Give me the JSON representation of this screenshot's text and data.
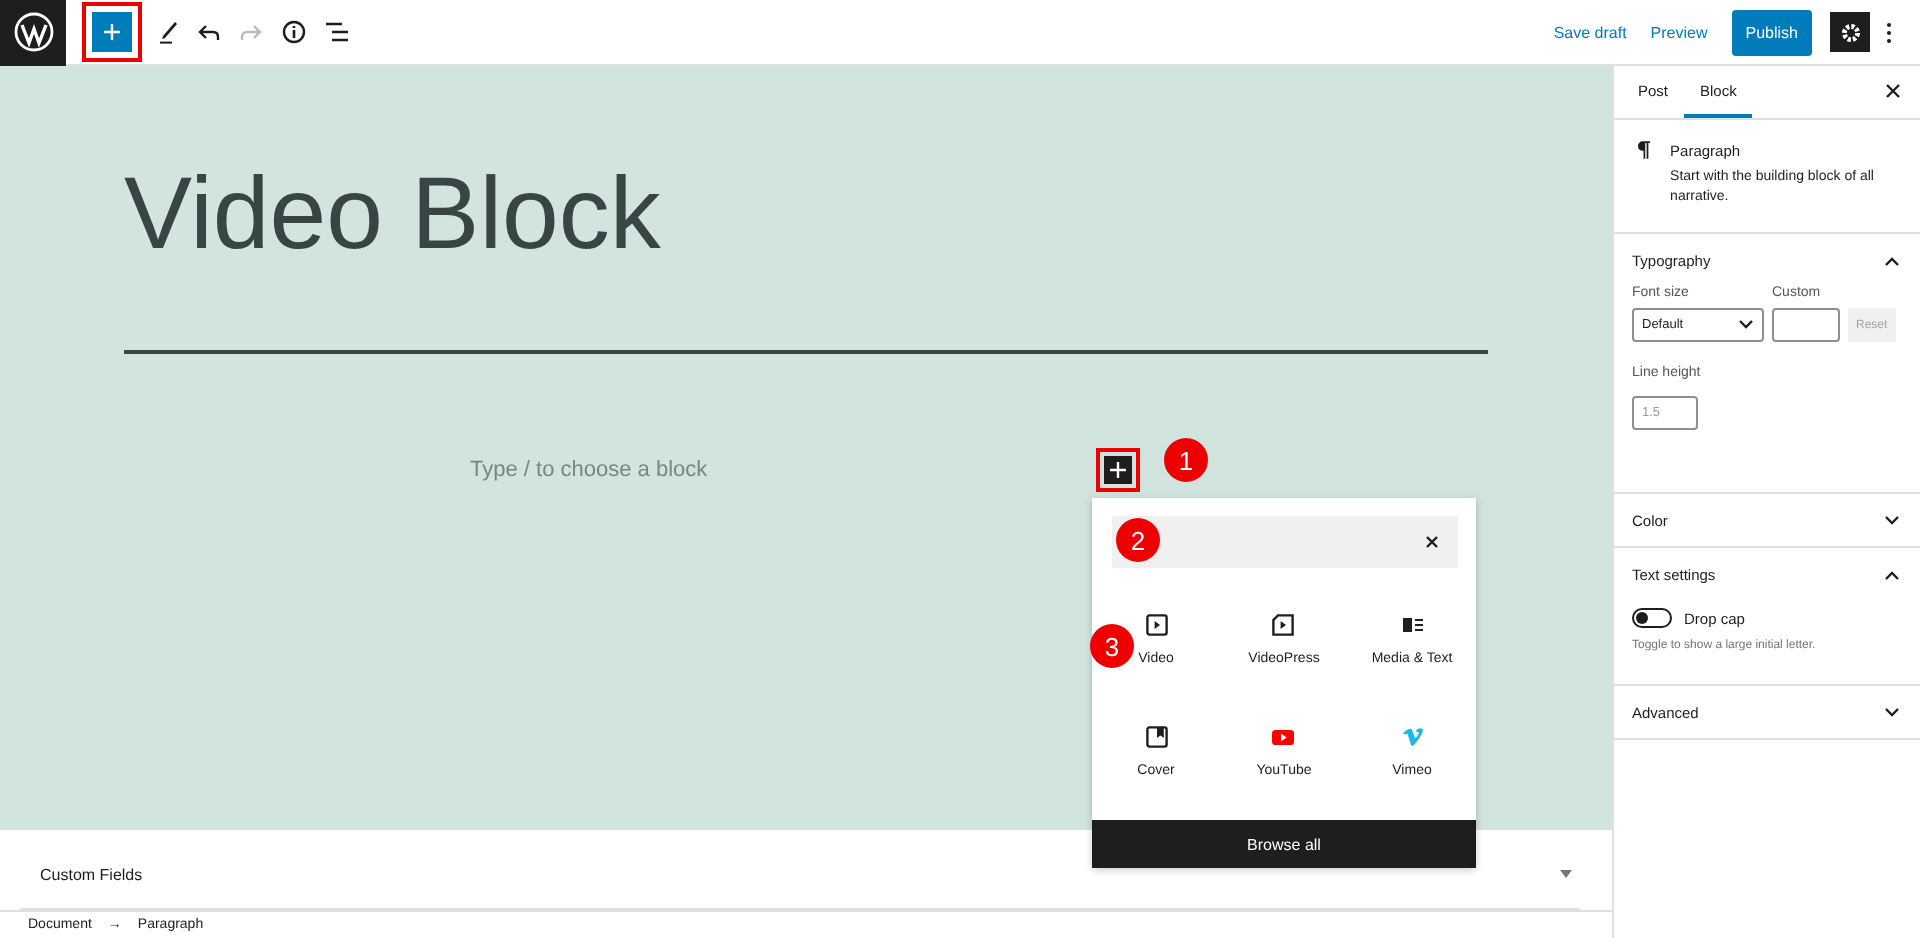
{
  "toolbar": {
    "inserter_open": true,
    "redo_disabled": true
  },
  "actions": [
    {
      "label": "Save draft",
      "kind": "link"
    },
    {
      "label": "Preview",
      "kind": "link"
    },
    {
      "label": "Publish",
      "kind": "primary"
    }
  ],
  "editor": {
    "title": "Video Block",
    "placeholder": "Type / to choose a block"
  },
  "annotations": [
    "1",
    "2",
    "3"
  ],
  "inserter": {
    "blocks": [
      {
        "label": "Video",
        "kind": "video"
      },
      {
        "label": "VideoPress",
        "kind": "videopress"
      },
      {
        "label": "Media & Text",
        "kind": "media-text"
      },
      {
        "label": "Cover",
        "kind": "cover"
      },
      {
        "label": "YouTube",
        "kind": "youtube"
      },
      {
        "label": "Vimeo",
        "kind": "vimeo"
      }
    ],
    "footer": "Browse all"
  },
  "custom_fields": {
    "title": "Custom Fields",
    "expanded": false
  },
  "breadcrumb": {
    "items": [
      "Document",
      "Paragraph"
    ],
    "separator": "→"
  },
  "sidebar": {
    "tabs": [
      {
        "label": "Post",
        "selected": false
      },
      {
        "label": "Block",
        "selected": true
      }
    ],
    "block_card": {
      "name": "Paragraph",
      "description": "Start with the building block of all narrative."
    },
    "panels": [
      {
        "title": "Typography",
        "expanded": true,
        "kind": "typography",
        "font_size_label": "Font size",
        "font_size": "Default",
        "custom_label": "Custom",
        "reset": "Reset",
        "reset_disabled": true,
        "line_height_label": "Line height",
        "line_height_placeholder": "1.5"
      },
      {
        "title": "Color",
        "expanded": false
      },
      {
        "title": "Text settings",
        "expanded": true,
        "kind": "text",
        "toggle_label": "Drop cap",
        "toggle_on": false,
        "help": "Toggle to show a large initial letter."
      },
      {
        "title": "Advanced",
        "expanded": false
      }
    ]
  }
}
